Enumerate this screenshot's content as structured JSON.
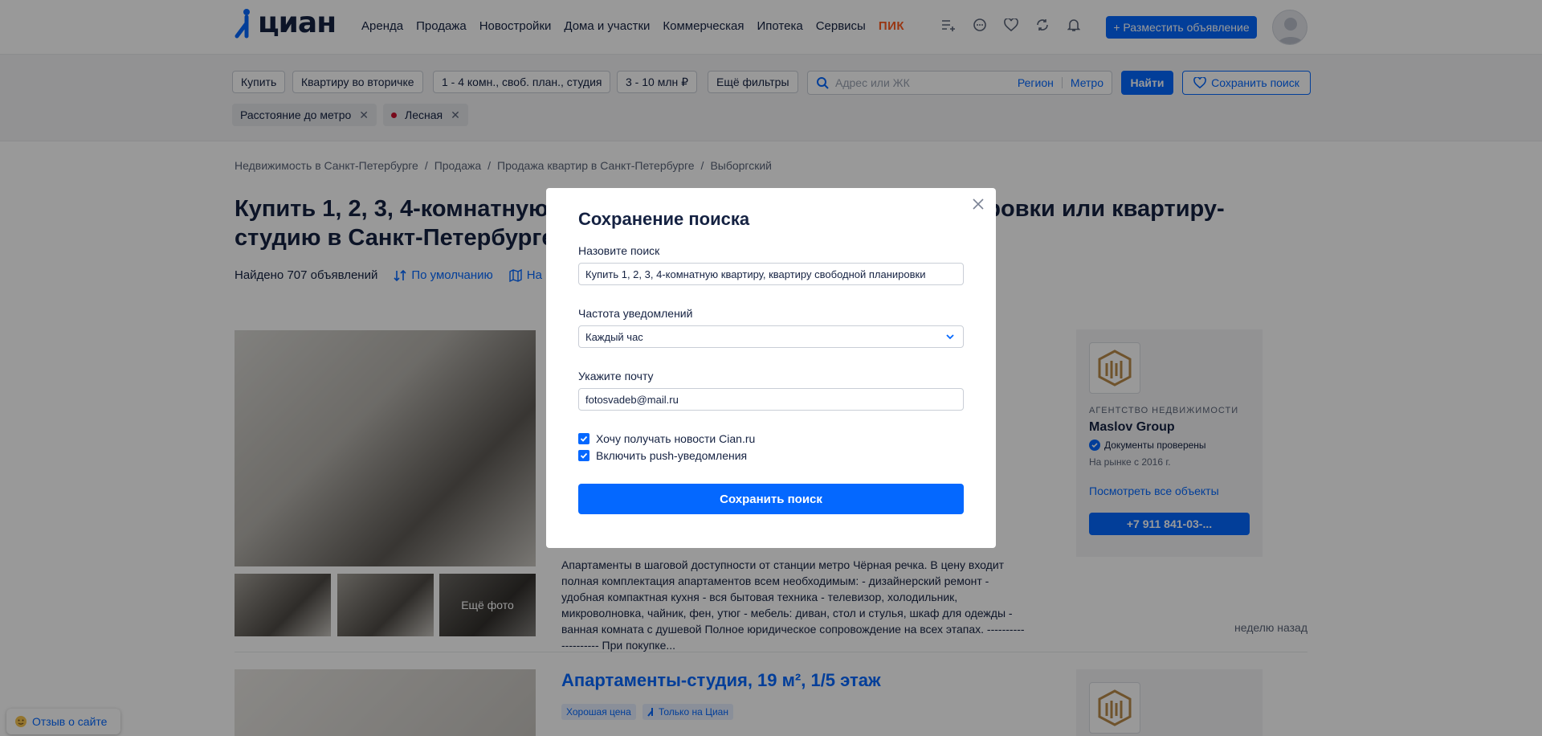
{
  "header": {
    "logo_text": "циан",
    "nav": [
      "Аренда",
      "Продажа",
      "Новостройки",
      "Дома и участки",
      "Коммерческая",
      "Ипотека",
      "Сервисы"
    ],
    "pik": "ПИК",
    "post_button": "+ Разместить объявление"
  },
  "filters": {
    "deal": "Купить",
    "object": "Квартиру во вторичке",
    "rooms": "1 - 4 комн., своб. план., студия",
    "price": "3 - 10 млн ₽",
    "more": "Ещё фильтры",
    "search_placeholder": "Адрес или ЖК",
    "region": "Регион",
    "metro": "Метро",
    "find": "Найти",
    "save_search": "Сохранить поиск",
    "chips": [
      "Расстояние до метро",
      "Лесная"
    ]
  },
  "content": {
    "breadcrumb": [
      "Недвижимость в Санкт-Петербурге",
      "Продажа",
      "Продажа квартир в Санкт-Петербурге",
      "Выборгский"
    ],
    "title": "Купить 1, 2, 3, 4-комнатную квартиру, квартиру свободной планировки или квартиру-студию в Санкт-Петербурге рядом с метро Лесная",
    "found": "Найдено 707 объявлений",
    "sort": "По умолчанию",
    "map": "На карте",
    "more_photos": "Ещё фото",
    "description": "Апартаменты в шаговой доступности от станции метро Чёрная речка. В цену входит полная комплектация апартаментов всем необходимым: - дизайнерский ремонт - удобная компактная кухня - вся бытовая техника - телевизор, холодильник, микроволновка, чайник, фен, утюг - мебель: диван, стол и стулья, шкаф для одежды - ванная комната с душевой Полное юридическое сопровождение на всех этапах. -------------------- При покупке...",
    "posted": "неделю назад",
    "agent": {
      "label": "АГЕНТСТВО НЕДВИЖИМОСТИ",
      "name": "Maslov Group",
      "verified": "Документы проверены",
      "since": "На рынке с 2016 г.",
      "all_objects": "Посмотреть все объекты",
      "phone": "+7 911 841-03-..."
    },
    "listing2_title": "Апартаменты-студия, 19 м², 1/5 этаж",
    "tags": [
      "Хорошая цена",
      "Только на Циан"
    ],
    "feedback": "Отзыв о сайте"
  },
  "modal": {
    "title": "Сохранение поиска",
    "name_label": "Назовите поиск",
    "name_value": "Купить 1, 2, 3, 4-комнатную квартиру, квартиру свободной планировки",
    "freq_label": "Частота уведомлений",
    "freq_value": "Каждый час",
    "email_label": "Укажите почту",
    "email_value": "fotosvadeb@mail.ru",
    "news_checkbox": "Хочу получать новости Cian.ru",
    "news_checked": true,
    "push_checkbox": "Включить push-уведомления",
    "push_checked": true,
    "submit": "Сохранить поиск"
  },
  "colors": {
    "accent": "#0468ff",
    "text": "#152242",
    "pik": "#ff5a1f"
  }
}
